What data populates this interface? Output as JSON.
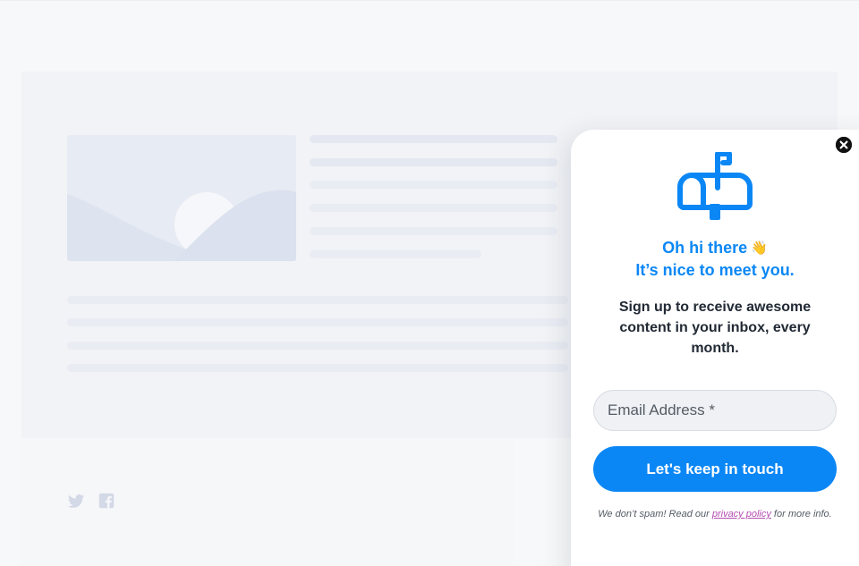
{
  "background": {
    "social_icons": [
      "twitter-icon",
      "facebook-icon"
    ]
  },
  "popup": {
    "icon": "mailbox-icon",
    "close_icon": "close-icon",
    "greeting_line1": "Oh hi there",
    "wave_emoji": "👋",
    "greeting_line2": "It’s nice to meet you.",
    "subtext": "Sign up to receive awesome content in your inbox, every month.",
    "email_placeholder": "Email Address *",
    "email_value": "",
    "button_label": "Let's keep in touch",
    "disclaimer_prefix": "We don’t spam! Read our ",
    "privacy_link": "privacy policy",
    "disclaimer_suffix": " for more info."
  },
  "colors": {
    "accent": "#0b87f5",
    "link": "#b44bb0",
    "skeleton": "#e4e8f1"
  }
}
